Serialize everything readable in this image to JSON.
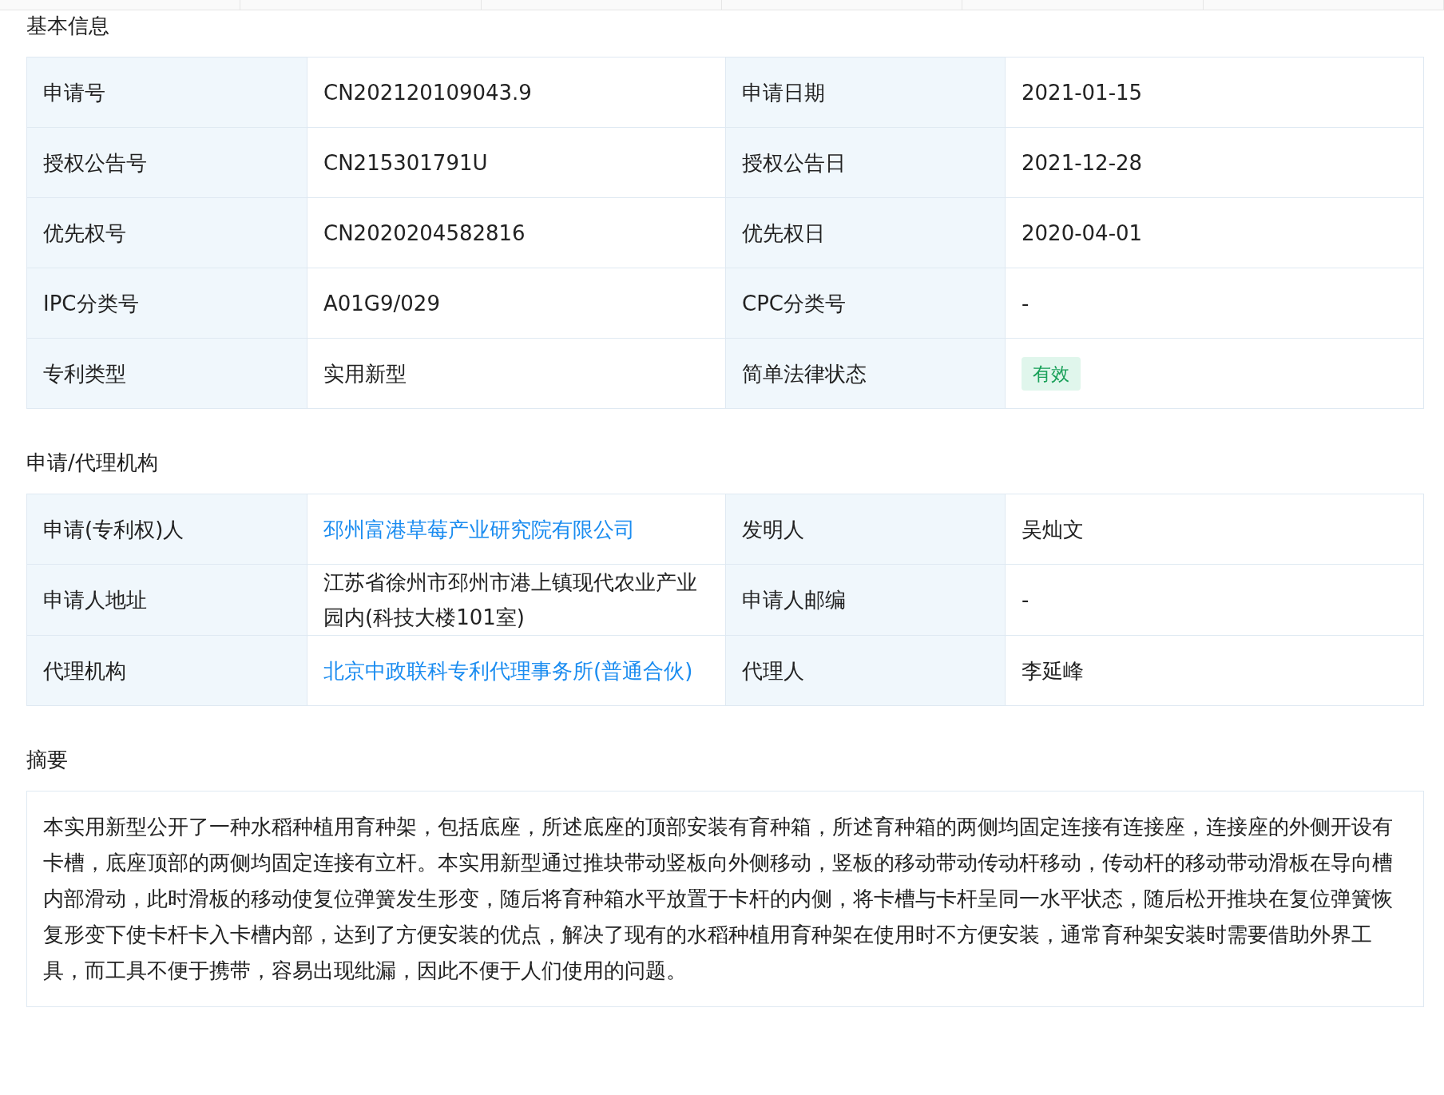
{
  "sections": [
    {
      "kind": "table",
      "title": "基本信息",
      "rows": [
        [
          {
            "label": "申请号",
            "value": "CN202120109043.9",
            "kind": "text"
          },
          {
            "label": "申请日期",
            "value": "2021-01-15",
            "kind": "text"
          }
        ],
        [
          {
            "label": "授权公告号",
            "value": "CN215301791U",
            "kind": "text"
          },
          {
            "label": "授权公告日",
            "value": "2021-12-28",
            "kind": "text"
          }
        ],
        [
          {
            "label": "优先权号",
            "value": "CN2020204582816",
            "kind": "text"
          },
          {
            "label": "优先权日",
            "value": "2020-04-01",
            "kind": "text"
          }
        ],
        [
          {
            "label": "IPC分类号",
            "value": "A01G9/029",
            "kind": "text"
          },
          {
            "label": "CPC分类号",
            "value": "-",
            "kind": "text"
          }
        ],
        [
          {
            "label": "专利类型",
            "value": "实用新型",
            "kind": "text"
          },
          {
            "label": "简单法律状态",
            "value": "有效",
            "kind": "tag"
          }
        ]
      ]
    },
    {
      "kind": "table",
      "title": "申请/代理机构",
      "rows": [
        [
          {
            "label": "申请(专利权)人",
            "value": "邳州富港草莓产业研究院有限公司",
            "kind": "link"
          },
          {
            "label": "发明人",
            "value": "吴灿文",
            "kind": "text"
          }
        ],
        [
          {
            "label": "申请人地址",
            "value": "江苏省徐州市邳州市港上镇现代农业产业园内(科技大楼101室)",
            "kind": "text"
          },
          {
            "label": "申请人邮编",
            "value": "-",
            "kind": "text"
          }
        ],
        [
          {
            "label": "代理机构",
            "value": "北京中政联科专利代理事务所(普通合伙)",
            "kind": "link"
          },
          {
            "label": "代理人",
            "value": "李延峰",
            "kind": "text"
          }
        ]
      ]
    },
    {
      "kind": "paragraph",
      "title": "摘要",
      "text": "本实用新型公开了一种水稻种植用育种架，包括底座，所述底座的顶部安装有育种箱，所述育种箱的两侧均固定连接有连接座，连接座的外侧开设有卡槽，底座顶部的两侧均固定连接有立杆。本实用新型通过推块带动竖板向外侧移动，竖板的移动带动传动杆移动，传动杆的移动带动滑板在导向槽内部滑动，此时滑板的移动使复位弹簧发生形变，随后将育种箱水平放置于卡杆的内侧，将卡槽与卡杆呈同一水平状态，随后松开推块在复位弹簧恢复形变下使卡杆卡入卡槽内部，达到了方便安装的优点，解决了现有的水稻种植用育种架在使用时不方便安装，通常育种架安装时需要借助外界工具，而工具不便于携带，容易出现纰漏，因此不便于人们使用的问题。"
    }
  ]
}
